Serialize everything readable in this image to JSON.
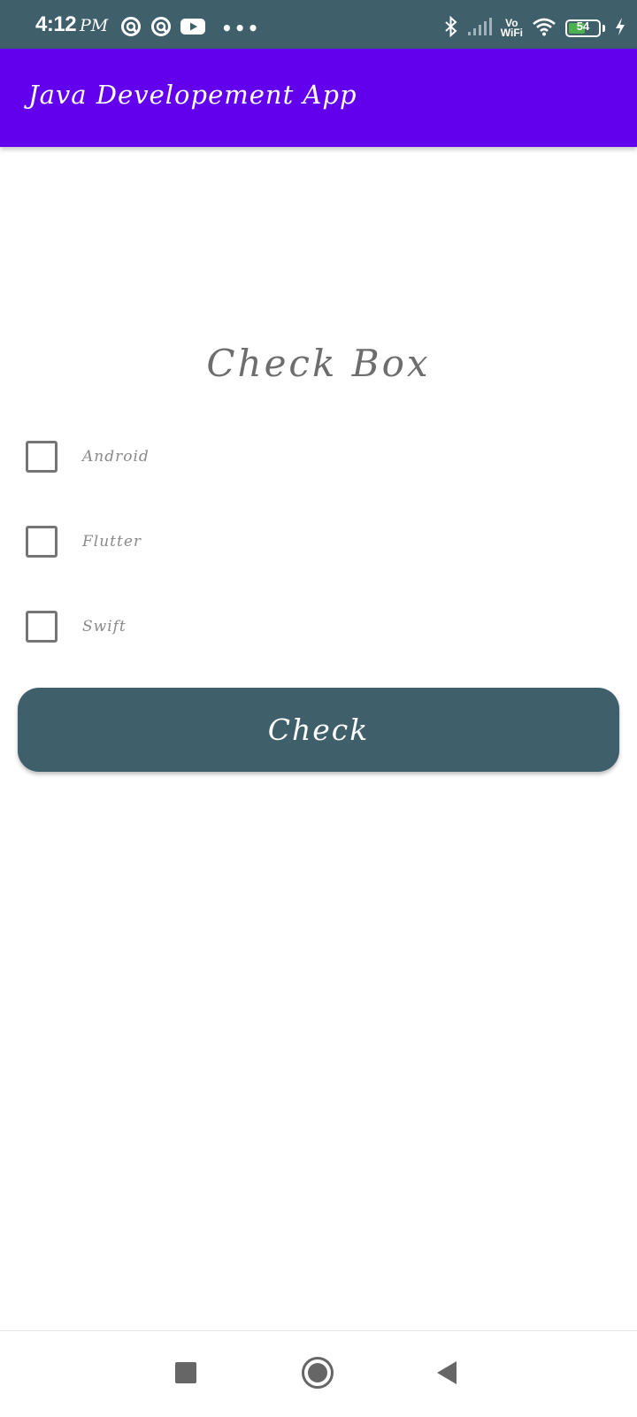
{
  "status_bar": {
    "time": "4:12",
    "ampm": "PM",
    "dots": "•••",
    "vo": "Vo",
    "wifi_label": "WiFi",
    "battery_level": "54",
    "icons_left": [
      "app-notification-icon",
      "app-notification-icon",
      "youtube-icon"
    ],
    "icons_right": [
      "bluetooth-icon",
      "signal-icon",
      "wifi-icon",
      "battery-icon",
      "charging-icon"
    ]
  },
  "app_bar": {
    "title": "Java Developement App",
    "color": "#6200ee"
  },
  "main": {
    "title": "Check Box",
    "checkboxes": [
      {
        "label": "Android",
        "checked": false
      },
      {
        "label": "Flutter",
        "checked": false
      },
      {
        "label": "Swift",
        "checked": false
      }
    ],
    "button_label": "Check",
    "button_color": "#3f5f6b"
  },
  "nav_bar": {
    "icons": [
      "recents-icon",
      "home-icon",
      "back-icon"
    ]
  }
}
